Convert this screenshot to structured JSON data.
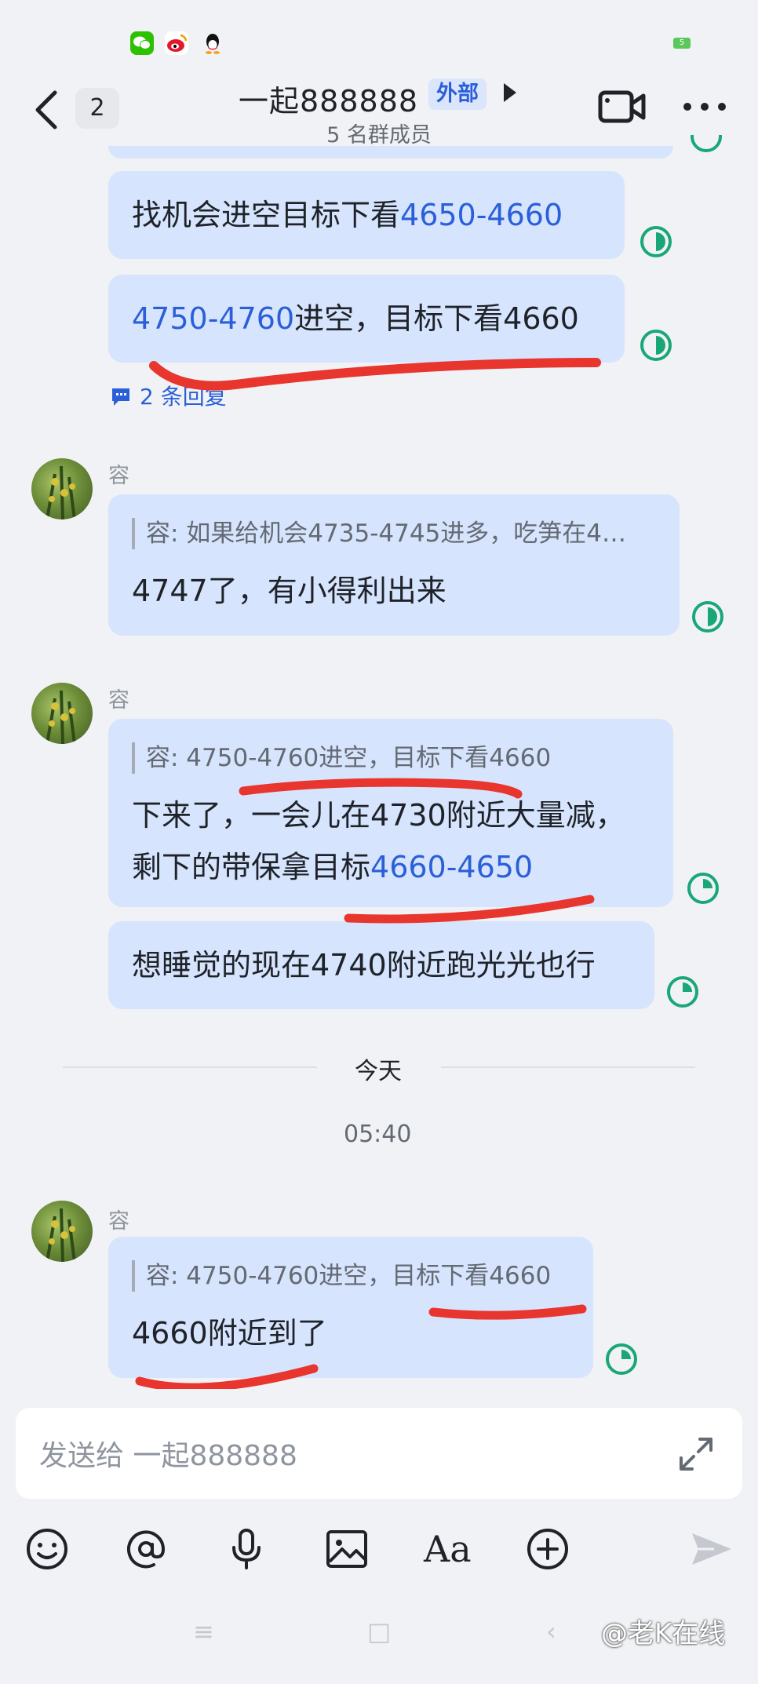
{
  "status_bar": {
    "apps": [
      "wechat-app-icon",
      "weibo-app-icon",
      "qq-app-icon"
    ],
    "battery_text": "5"
  },
  "header": {
    "unread_count": "2",
    "title": "一起888888",
    "external_tag": "外部",
    "subtitle": "5 名群成员"
  },
  "messages": {
    "m1_text": "找机会进空目标下看",
    "m1_range": "4650-4660",
    "m2_range": "4750-4760",
    "m2_text": "进空，目标下看4660",
    "m2_replies": "2 条回复",
    "s1_sender": "容",
    "s1_quote": "容: 如果给机会4735-4745进多，吃笋在4…",
    "s1_text": "4747了，有小得利出来",
    "s2_sender": "容",
    "s2_quote": "容: 4750-4760进空，目标下看4660",
    "s2_line1": "下来了，一会儿在4730附近大量减，",
    "s2_line2_prefix": "剩下的带保拿目标",
    "s2_line2_range": "4660-4650",
    "s3_text": "想睡觉的现在4740附近跑光光也行",
    "date_divider": "今天",
    "time": "05:40",
    "s4_sender": "容",
    "s4_quote": "容: 4750-4760进空，目标下看4660",
    "s4_text": "4660附近到了"
  },
  "input": {
    "placeholder": "发送给 一起888888"
  },
  "toolbar": [
    "emoji-icon",
    "at-icon",
    "microphone-icon",
    "image-icon",
    "font-icon",
    "add-icon",
    "send-icon"
  ],
  "toolbar_font_label": "Aa",
  "nav": {
    "menu_glyph": "≡",
    "home_glyph": "□",
    "back_glyph": "‹"
  },
  "watermark": "@老K在线",
  "colors": {
    "bubble": "#d6e4fd",
    "link_blue": "#2b5fd9",
    "read_green": "#1aa777",
    "annotation_red": "#e8352e"
  }
}
